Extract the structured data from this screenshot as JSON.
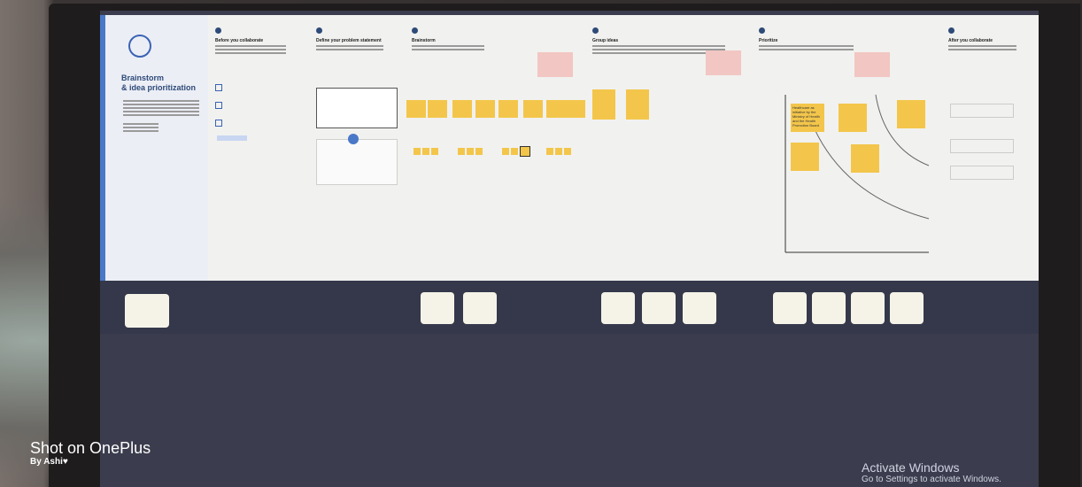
{
  "template": {
    "title_line1": "Brainstorm",
    "title_line2": "& idea prioritization"
  },
  "panels": [
    {
      "id": "prep",
      "title": "Before you collaborate"
    },
    {
      "id": "define",
      "title": "Define your problem statement"
    },
    {
      "id": "brainstorm",
      "title": "Brainstorm"
    },
    {
      "id": "group",
      "title": "Group ideas"
    },
    {
      "id": "prioritize",
      "title": "Prioritize"
    },
    {
      "id": "after",
      "title": "After you collaborate"
    }
  ],
  "prioritize_notes": [
    "Healthcare as initiative by the Ministry of Health and the Health Promotion Board"
  ],
  "photo_watermark": {
    "line1": "Shot on OnePlus",
    "line2": "By Ashi♥"
  },
  "windows_notice": {
    "line1": "Activate Windows",
    "line2": "Go to Settings to activate Windows."
  },
  "colors": {
    "accent": "#2d4a78",
    "sticky": "#f3c64b",
    "screen_bg": "#3b3d4e"
  }
}
